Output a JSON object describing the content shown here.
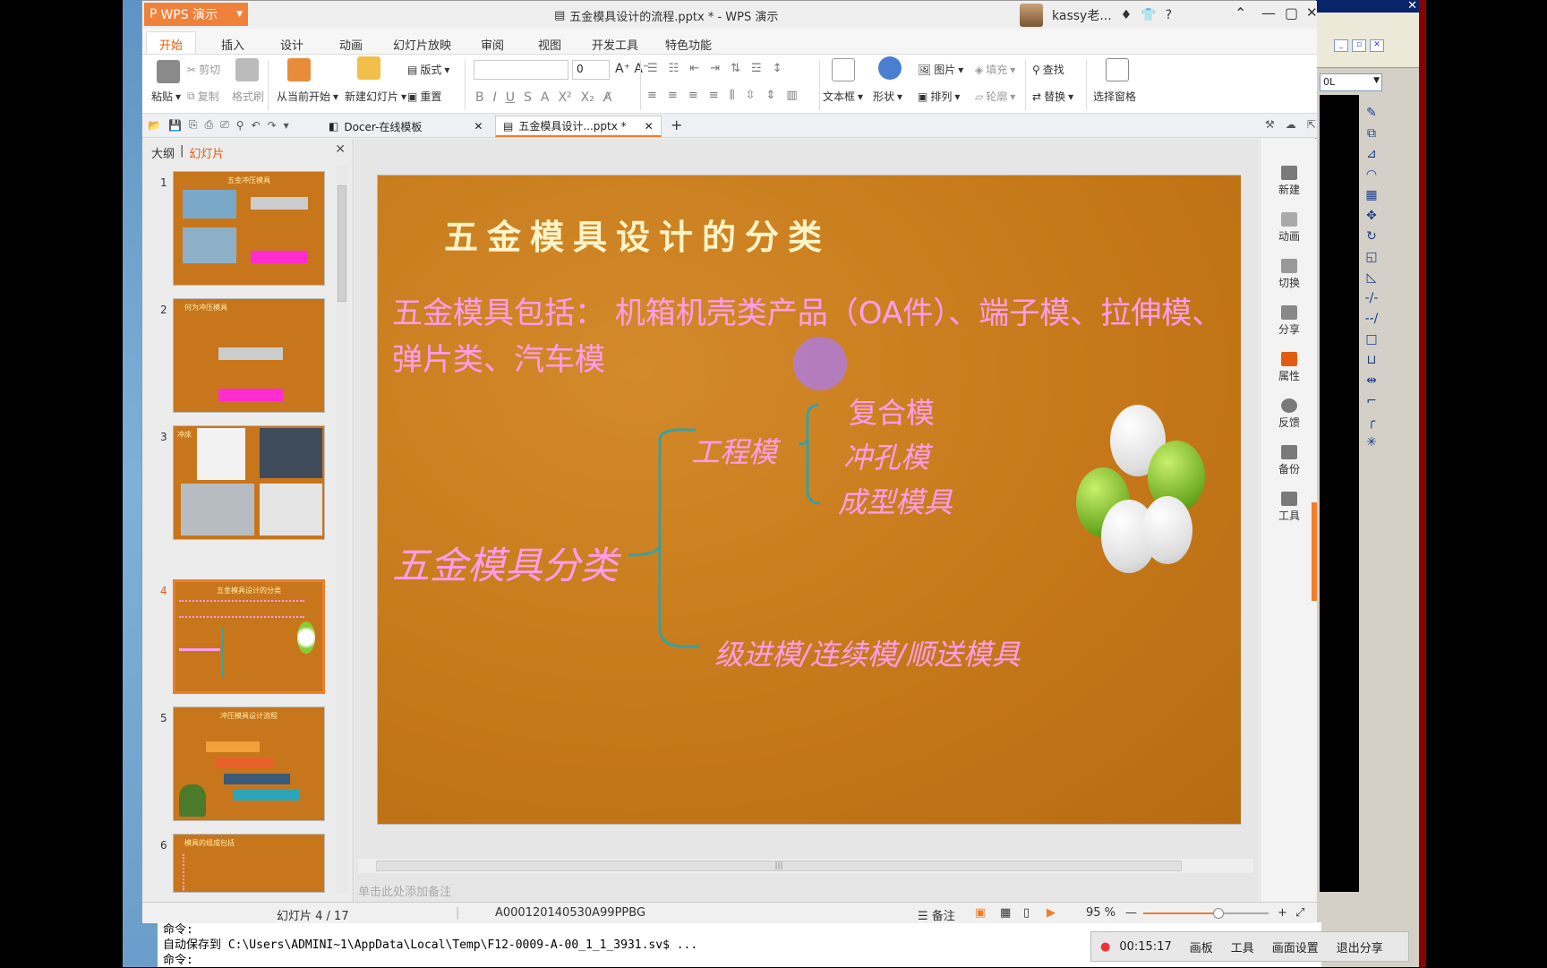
{
  "window": {
    "app_button": "WPS 演示",
    "title": "五金模具设计的流程.pptx * - WPS 演示",
    "user": "kassy老...",
    "help": "?"
  },
  "menu": {
    "tabs": [
      "开始",
      "插入",
      "设计",
      "动画",
      "幻灯片放映",
      "审阅",
      "视图",
      "开发工具",
      "特色功能"
    ]
  },
  "ribbon": {
    "paste": "粘贴",
    "cut": "剪切",
    "copy": "复制",
    "format_painter": "格式刷",
    "from_current": "从当前开始",
    "new_slide": "新建幻灯片",
    "layout": "版式",
    "reset": "重置",
    "font_size": "0",
    "text_box": "文本框",
    "shape": "形状",
    "picture": "图片",
    "fill": "填充",
    "arrange": "排列",
    "outline": "轮廓",
    "find": "查找",
    "replace": "替换",
    "selection_pane": "选择窗格"
  },
  "doc_tabs": [
    "Docer-在线模板",
    "五金模具设计...pptx *"
  ],
  "left_pane": {
    "outline_tab": "大纲",
    "slides_tab": "幻灯片",
    "thumb_titles": [
      "五金冲压模具",
      "何为冲压模具",
      "冲床",
      "五金模具设计的分类",
      "冲压模具设计流程",
      "模具的组成包括"
    ],
    "slide_numbers": [
      "1",
      "2",
      "3",
      "4",
      "5",
      "6"
    ]
  },
  "slide": {
    "title": "五金模具设计的分类",
    "body": "五金模具包括：  机箱机壳类产品（OA件）、端子模、拉伸模、弹片类、汽车模",
    "root": "五金模具分类",
    "branch1": "工程模",
    "leaf1": "复合模",
    "leaf2": "冲孔模",
    "leaf3": "成型模具",
    "branch2": "级进模/连续模/顺送模具"
  },
  "notes_placeholder": "单击此处添加备注",
  "right_sidebar": [
    "新建",
    "动画",
    "切换",
    "分享",
    "属性",
    "反馈",
    "备份",
    "工具"
  ],
  "status": {
    "slide_counter": "幻灯片 4 / 17",
    "template_id": "A000120140530A99PPBG",
    "notes": "备注",
    "zoom": "95 %",
    "zoom_level": 0.6
  },
  "cad": {
    "combo_value": "0L",
    "cmd_lines": [
      "命令:",
      "自动保存到 C:\\Users\\ADMINI~1\\AppData\\Local\\Temp\\F12-0009-A-00_1_1_3931.sv$ ...",
      "命令:"
    ]
  },
  "recorder": {
    "time": "00:15:17",
    "board": "画板",
    "tools": "工具",
    "screen_settings": "画面设置",
    "exit": "退出分享"
  },
  "colors": {
    "accent": "#f07d2a",
    "slide_bg": "#c47718",
    "slide_text": "#ff9df0",
    "title_text": "#fff4c8"
  }
}
